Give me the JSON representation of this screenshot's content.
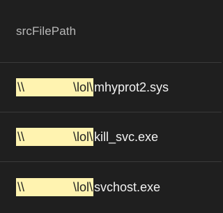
{
  "header": {
    "label": "srcFilePath"
  },
  "rows": [
    {
      "prefix": "\\\\",
      "redacted": "",
      "lol": "\\lol\\",
      "file": "mhyprot2.sys"
    },
    {
      "prefix": "\\\\",
      "redacted": "",
      "lol": "\\lol\\",
      "file": "kill_svc.exe"
    },
    {
      "prefix": "\\\\",
      "redacted": "",
      "lol": "\\lol\\",
      "file": "svchost.exe"
    }
  ],
  "colors": {
    "background": "#1f1f1f",
    "highlight": "#fff3b0",
    "text": "#f2f2f2",
    "header_text": "#b9b9b9",
    "divider": "#3a3a3a"
  }
}
